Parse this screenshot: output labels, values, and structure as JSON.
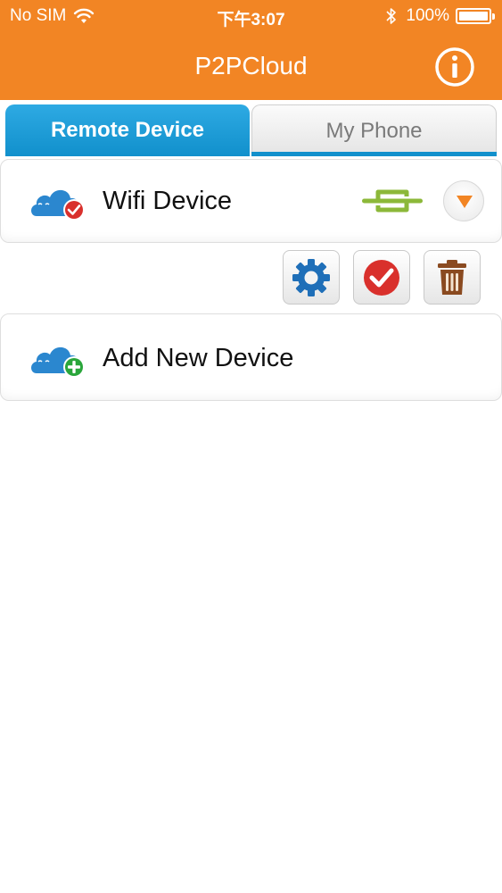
{
  "status_bar": {
    "carrier": "No SIM",
    "time": "下午3:07",
    "battery": "100%"
  },
  "nav": {
    "title": "P2PCloud"
  },
  "tabs": [
    {
      "label": "Remote Device",
      "active": true
    },
    {
      "label": "My Phone",
      "active": false
    }
  ],
  "devices": [
    {
      "name": "Wifi Device",
      "status": "connected"
    }
  ],
  "add_device": {
    "label": "Add New Device"
  },
  "colors": {
    "accent": "#f28524",
    "tab_active": "#1190cc",
    "link_green": "#8cb839",
    "check_red": "#d9302c",
    "cloud_blue": "#2b87cf",
    "gear_blue": "#1f6fb8",
    "trash_brown": "#8a4a20",
    "add_green": "#2aa63b"
  },
  "icons": {
    "info": "info-icon",
    "cloud_check": "cloud-check-icon",
    "cloud_add": "cloud-add-icon",
    "link": "link-icon",
    "expand": "chevron-down-icon",
    "settings": "gear-icon",
    "select": "check-icon",
    "delete": "trash-icon"
  }
}
